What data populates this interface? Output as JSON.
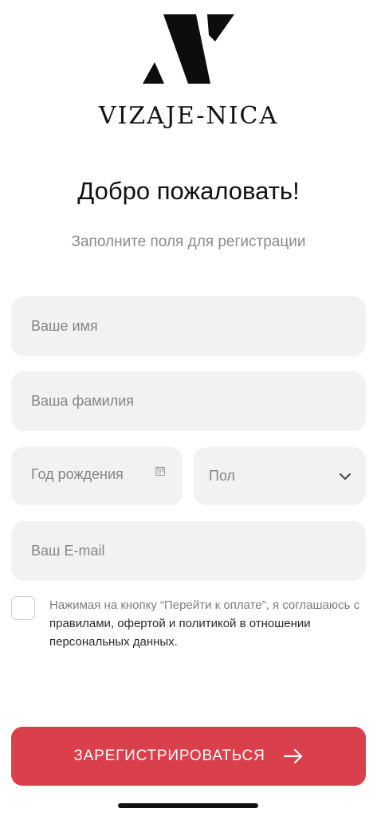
{
  "brand": {
    "name": "VIZAJE-NICA",
    "logo_icon": "v-monogram-logo"
  },
  "header": {
    "title": "Добро пожаловать!",
    "subtitle": "Заполните поля для регистрации"
  },
  "form": {
    "first_name": {
      "placeholder": "Ваше имя",
      "value": ""
    },
    "last_name": {
      "placeholder": "Ваша фамилия",
      "value": ""
    },
    "birth_year": {
      "placeholder": "Год рождения",
      "value": "",
      "icon": "calendar-icon"
    },
    "gender": {
      "selected": "Пол",
      "icon": "chevron-down-icon"
    },
    "email": {
      "placeholder": "Ваш E-mail",
      "value": ""
    }
  },
  "consent": {
    "checked": false,
    "text_before": "Нажимая на кнопку “Перейти к оплате”, я соглашаюсь с ",
    "links_text": "правилами, офертой и политикой в отношении персональных данных."
  },
  "submit": {
    "label": "ЗАРЕГИСТРИРОВАТЬСЯ",
    "icon": "arrow-right-icon"
  },
  "colors": {
    "accent": "#d9404c",
    "field_bg": "#f2f2f2",
    "placeholder": "#858585"
  }
}
